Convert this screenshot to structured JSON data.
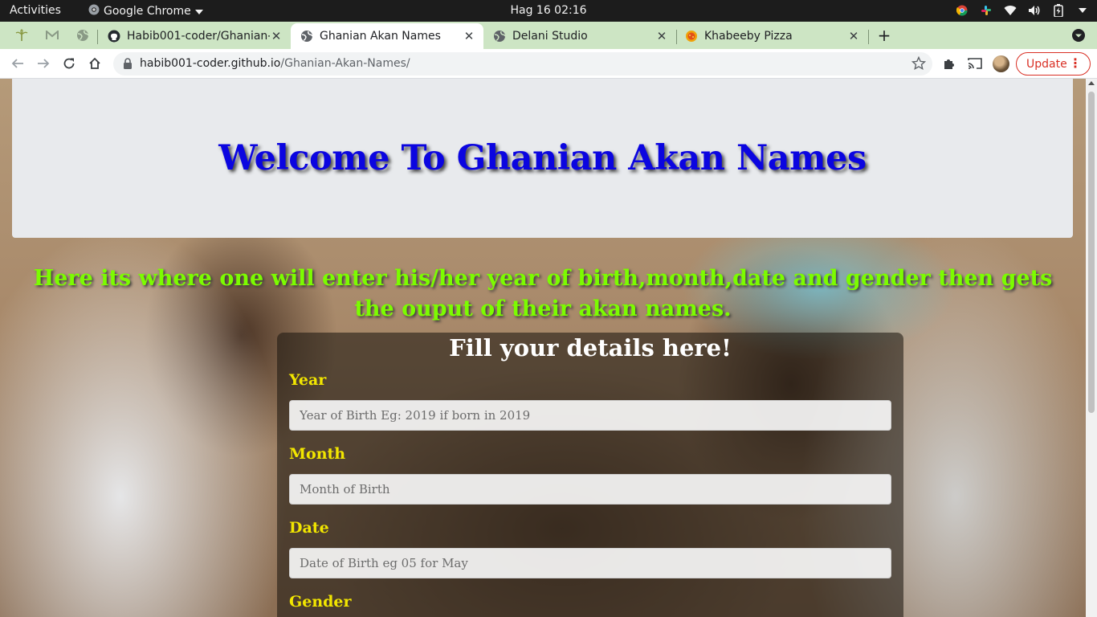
{
  "system_bar": {
    "activities": "Activities",
    "app_name": "Google Chrome",
    "clock": "Hag 16  02:16"
  },
  "browser": {
    "tabs": [
      {
        "title": "Habib001-coder/Ghanian-",
        "icon": "github-icon",
        "active": false
      },
      {
        "title": "Ghanian Akan Names",
        "icon": "globe-icon",
        "active": true
      },
      {
        "title": "Delani Studio",
        "icon": "globe-icon",
        "active": false
      },
      {
        "title": "Khabeeby Pizza",
        "icon": "pizza-icon",
        "active": false
      }
    ],
    "address": {
      "host": "habib001-coder.github.io",
      "path": "/Ghanian-Akan-Names/"
    },
    "update_label": "Update"
  },
  "page": {
    "heading": "Welcome To Ghanian Akan Names",
    "intro": "Here its where one will enter his/her year of birth,month,date and gender then gets the ouput of their akan names.",
    "form_title": "Fill your details here!",
    "fields": [
      {
        "label": "Year",
        "placeholder": "Year of Birth Eg: 2019 if born in 2019"
      },
      {
        "label": "Month",
        "placeholder": "Month of Birth"
      },
      {
        "label": "Date",
        "placeholder": "Date of Birth eg 05 for May"
      }
    ],
    "gender_label": "Gender"
  },
  "colors": {
    "heading": "#0b05e0",
    "intro_text": "#7cfc00",
    "field_label": "#f2e600",
    "tabstrip": "#cde5c4",
    "update_accent": "#d93025"
  }
}
